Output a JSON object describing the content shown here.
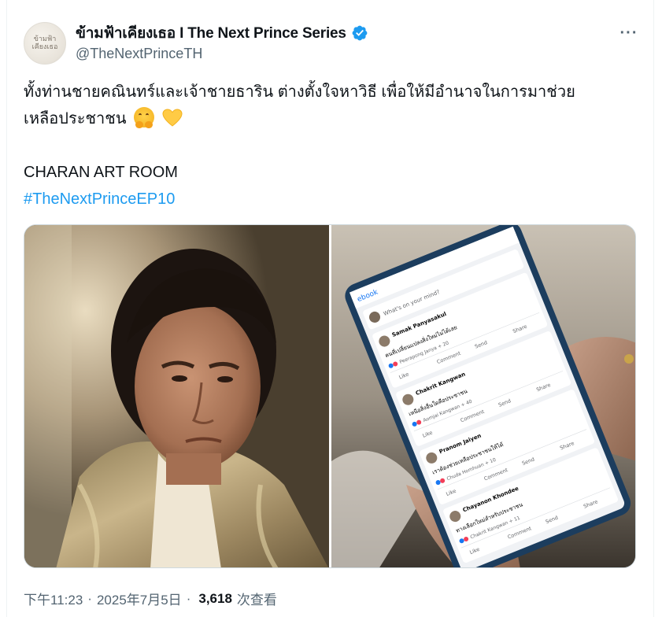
{
  "tweet": {
    "author": {
      "display_name": "ข้ามฟ้าเคียงเธอ I The Next Prince Series",
      "handle": "@TheNextPrinceTH",
      "avatar_text_line1": "ข้ามฟ้า",
      "avatar_text_line2": "เคียงเธอ",
      "verified": true
    },
    "more_label": "···",
    "text_line1": "ทั้งท่านชายคณินทร์และเจ้าชายธาริน ต่างตั้งใจหาวิธี เพื่อให้มีอำนาจในการมาช่วย",
    "text_line2": "เหลือประชาชน",
    "credit": "CHARAN ART ROOM",
    "hashtag": "#TheNextPrinceEP10",
    "emojis": [
      "hugging-face",
      "yellow-heart"
    ],
    "meta": {
      "time": "下午11:23",
      "date": "2025年7月5日",
      "views_count": "3,618",
      "views_label": "次查看"
    }
  },
  "tablet_feed": {
    "composer_placeholder": "What's on your mind?",
    "brand_fragment": "ebook",
    "posts": [
      {
        "name": "Samak Panyasakul",
        "snippet": "คนที่เปลี่ยนแปลงสิ่งใหม่ไม่ได้เลย",
        "reactor": "Peerapong Janya + 20"
      },
      {
        "name": "Chakrit Kangwan",
        "snippet": "เหนือสิ่งอื่นใดคือประชาชน",
        "reactor": "Aomjai Kangwan + 40"
      },
      {
        "name": "Pranom Jaiyen",
        "snippet": "เราต้องช่วยเหลือประชาชนให้ได้",
        "reactor": "Chuda Homhuan + 10"
      },
      {
        "name": "Chayanon Khondee",
        "snippet": "ทางเลือกใหม่สำหรับประชาชน",
        "reactor": "Chakrit Kangwan + 11"
      }
    ],
    "like_label": "Like",
    "comment_label": "Comment",
    "send_label": "Send",
    "share_label": "Share"
  },
  "colors": {
    "text_primary": "#0f1419",
    "text_secondary": "#536471",
    "accent": "#1d9bf0",
    "border": "#cfd9de"
  }
}
